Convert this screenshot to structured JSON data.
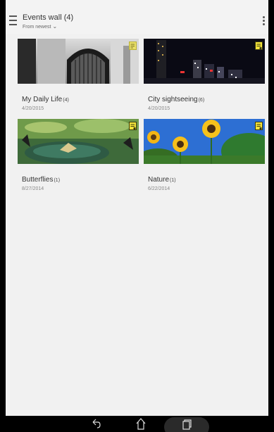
{
  "header": {
    "title": "Events wall (4)",
    "sort_label": "From newest",
    "sort_chevron": "⌄"
  },
  "events": [
    {
      "name": "My Daily Life",
      "count": "(4)",
      "date": "4/20/2015",
      "badge_state": "partial"
    },
    {
      "name": "City sightseeing",
      "count": "(6)",
      "date": "4/20/2015",
      "badge_state": "active"
    },
    {
      "name": "Butterflies",
      "count": "(1)",
      "date": "8/27/2014",
      "badge_state": "active"
    },
    {
      "name": "Nature",
      "count": "(1)",
      "date": "6/22/2014",
      "badge_state": "active"
    }
  ],
  "icons": {
    "menu": "hamburger-menu-icon",
    "overflow": "more-vert-icon",
    "badge": "story-note-icon",
    "back": "back-icon",
    "home": "home-icon",
    "recent": "recent-apps-icon"
  },
  "colors": {
    "background": "#f1f1f1",
    "badge_yellow": "#f2e23a",
    "text_primary": "#333333",
    "text_secondary": "#888888"
  }
}
